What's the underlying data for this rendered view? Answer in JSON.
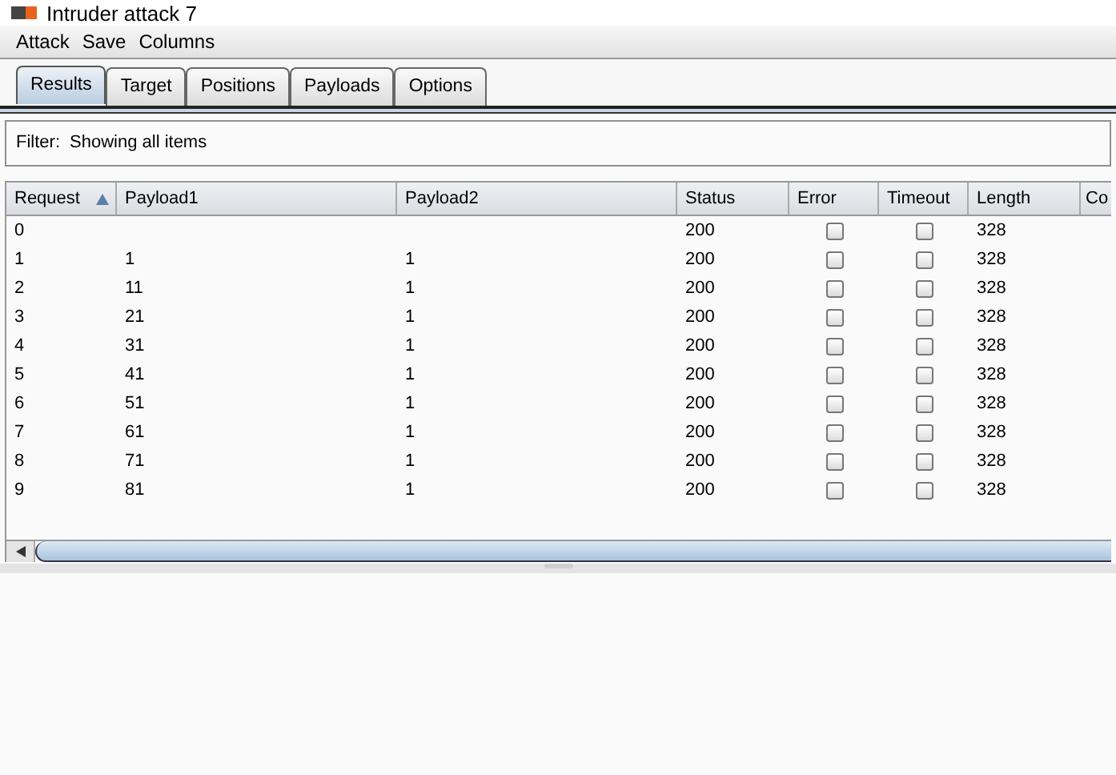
{
  "window": {
    "title": "Intruder attack 7"
  },
  "menu": [
    "Attack",
    "Save",
    "Columns"
  ],
  "tabs": [
    {
      "label": "Results",
      "selected": true
    },
    {
      "label": "Target",
      "selected": false
    },
    {
      "label": "Positions",
      "selected": false
    },
    {
      "label": "Payloads",
      "selected": false
    },
    {
      "label": "Options",
      "selected": false
    }
  ],
  "filter": {
    "label": "Filter:",
    "value": "Showing all items"
  },
  "table": {
    "columns": [
      {
        "label": "Request",
        "sorted": true
      },
      {
        "label": "Payload1",
        "sorted": false
      },
      {
        "label": "Payload2",
        "sorted": false
      },
      {
        "label": "Status",
        "sorted": false
      },
      {
        "label": "Error",
        "sorted": false
      },
      {
        "label": "Timeout",
        "sorted": false
      },
      {
        "label": "Length",
        "sorted": false
      },
      {
        "label": "Co",
        "sorted": false
      }
    ],
    "rows": [
      {
        "request": "0",
        "payload1": "",
        "payload2": "",
        "status": "200",
        "error": false,
        "timeout": false,
        "length": "328"
      },
      {
        "request": "1",
        "payload1": "1",
        "payload2": "1",
        "status": "200",
        "error": false,
        "timeout": false,
        "length": "328"
      },
      {
        "request": "2",
        "payload1": "11",
        "payload2": "1",
        "status": "200",
        "error": false,
        "timeout": false,
        "length": "328"
      },
      {
        "request": "3",
        "payload1": "21",
        "payload2": "1",
        "status": "200",
        "error": false,
        "timeout": false,
        "length": "328"
      },
      {
        "request": "4",
        "payload1": "31",
        "payload2": "1",
        "status": "200",
        "error": false,
        "timeout": false,
        "length": "328"
      },
      {
        "request": "5",
        "payload1": "41",
        "payload2": "1",
        "status": "200",
        "error": false,
        "timeout": false,
        "length": "328"
      },
      {
        "request": "6",
        "payload1": "51",
        "payload2": "1",
        "status": "200",
        "error": false,
        "timeout": false,
        "length": "328"
      },
      {
        "request": "7",
        "payload1": "61",
        "payload2": "1",
        "status": "200",
        "error": false,
        "timeout": false,
        "length": "328"
      },
      {
        "request": "8",
        "payload1": "71",
        "payload2": "1",
        "status": "200",
        "error": false,
        "timeout": false,
        "length": "328"
      },
      {
        "request": "9",
        "payload1": "81",
        "payload2": "1",
        "status": "200",
        "error": false,
        "timeout": false,
        "length": "328"
      }
    ]
  }
}
